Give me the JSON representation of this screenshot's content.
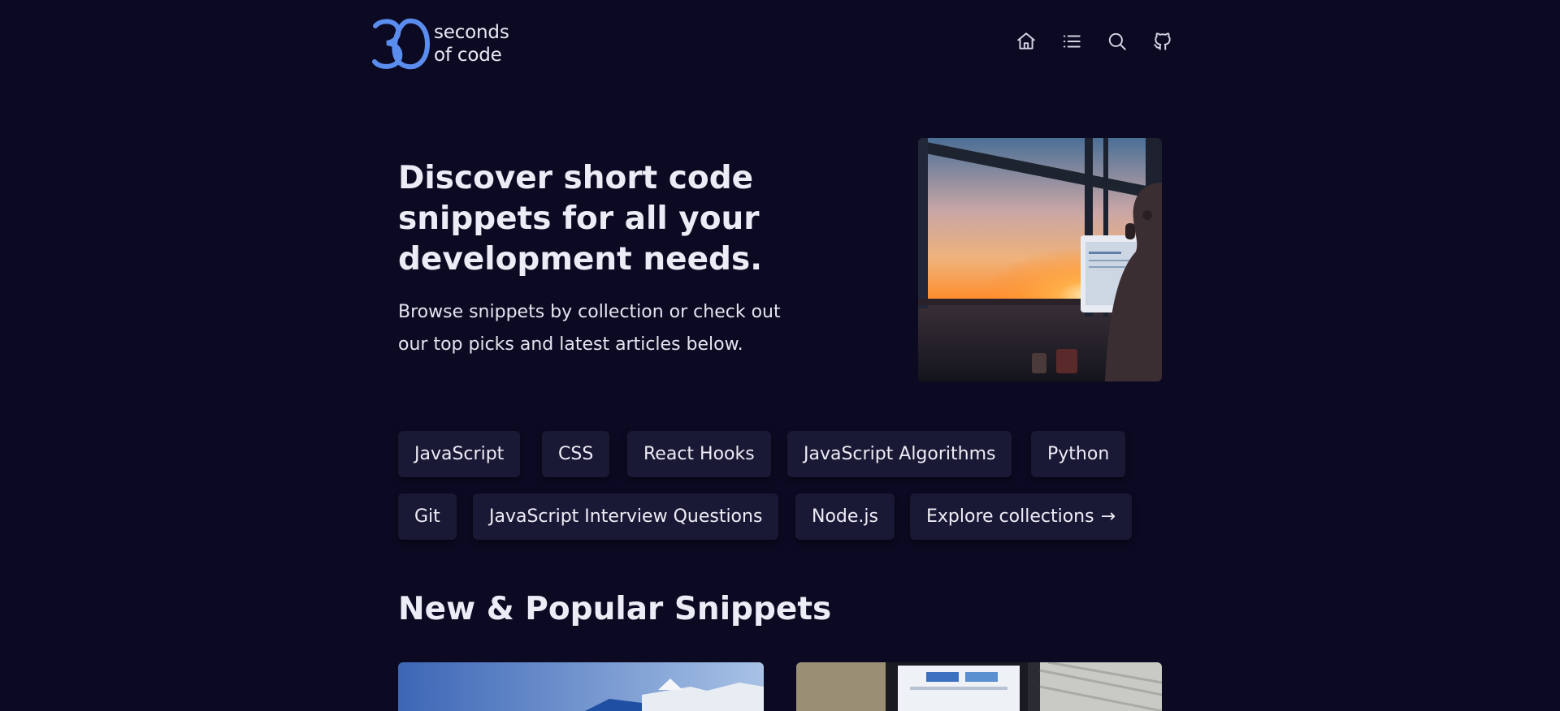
{
  "header": {
    "logo": {
      "line1": "seconds",
      "line2": "of code",
      "mark_color": "#5b8def"
    },
    "nav": [
      {
        "icon": "home-icon",
        "label": "Home"
      },
      {
        "icon": "list-icon",
        "label": "Collections"
      },
      {
        "icon": "search-icon",
        "label": "Search"
      },
      {
        "icon": "github-icon",
        "label": "GitHub"
      }
    ]
  },
  "hero": {
    "title": "Discover short code snippets for all your development needs.",
    "description": "Browse snippets by collection or check out our top picks and latest articles below."
  },
  "collections": [
    {
      "label": "JavaScript"
    },
    {
      "label": "CSS"
    },
    {
      "label": "React Hooks"
    },
    {
      "label": "JavaScript Algorithms"
    },
    {
      "label": "Python"
    },
    {
      "label": "Git"
    },
    {
      "label": "JavaScript Interview Questions"
    },
    {
      "label": "Node.js"
    },
    {
      "label": "Explore collections",
      "arrow": "→"
    }
  ],
  "section": {
    "title": "New & Popular Snippets"
  },
  "colors": {
    "background": "#0b0a22",
    "chip": "#191935",
    "accent": "#5b8def",
    "text": "#ececf6"
  }
}
